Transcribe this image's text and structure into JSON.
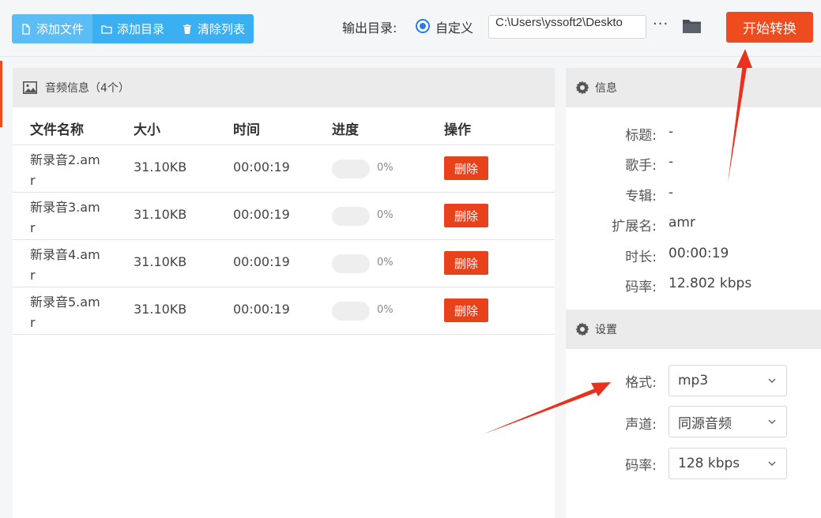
{
  "toolbar": {
    "add_file": "添加文件",
    "add_dir": "添加目录",
    "clear_list": "清除列表",
    "output_label": "输出目录:",
    "custom_label": "自定义",
    "output_path": "C:\\Users\\yssoft2\\Deskto",
    "more": "···",
    "start": "开始转换"
  },
  "list": {
    "title": "音频信息（4个）",
    "columns": {
      "name": "文件名称",
      "size": "大小",
      "time": "时间",
      "progress": "进度",
      "op": "操作"
    },
    "rows": [
      {
        "name": "新录音2.amr",
        "size": "31.10KB",
        "time": "00:00:19",
        "progress_pct": 0,
        "progress": "0%",
        "delete": "删除"
      },
      {
        "name": "新录音3.amr",
        "size": "31.10KB",
        "time": "00:00:19",
        "progress_pct": 0,
        "progress": "0%",
        "delete": "删除"
      },
      {
        "name": "新录音4.amr",
        "size": "31.10KB",
        "time": "00:00:19",
        "progress_pct": 0,
        "progress": "0%",
        "delete": "删除"
      },
      {
        "name": "新录音5.amr",
        "size": "31.10KB",
        "time": "00:00:19",
        "progress_pct": 0,
        "progress": "0%",
        "delete": "删除"
      }
    ]
  },
  "info": {
    "title": "信息",
    "items": [
      {
        "key": "标题:",
        "value": "-"
      },
      {
        "key": "歌手:",
        "value": "-"
      },
      {
        "key": "专辑:",
        "value": "-"
      },
      {
        "key": "扩展名:",
        "value": "amr"
      },
      {
        "key": "时长:",
        "value": "00:00:19"
      },
      {
        "key": "码率:",
        "value": "12.802 kbps"
      }
    ]
  },
  "settings": {
    "title": "设置",
    "format_label": "格式:",
    "format_value": "mp3",
    "channel_label": "声道:",
    "channel_value": "同源音频",
    "bitrate_label": "码率:",
    "bitrate_value": "128 kbps"
  },
  "colors": {
    "accent_blue": "#3ab0f2",
    "accent_red": "#ee4b1f",
    "annotation_arrow": "#e8321e"
  }
}
